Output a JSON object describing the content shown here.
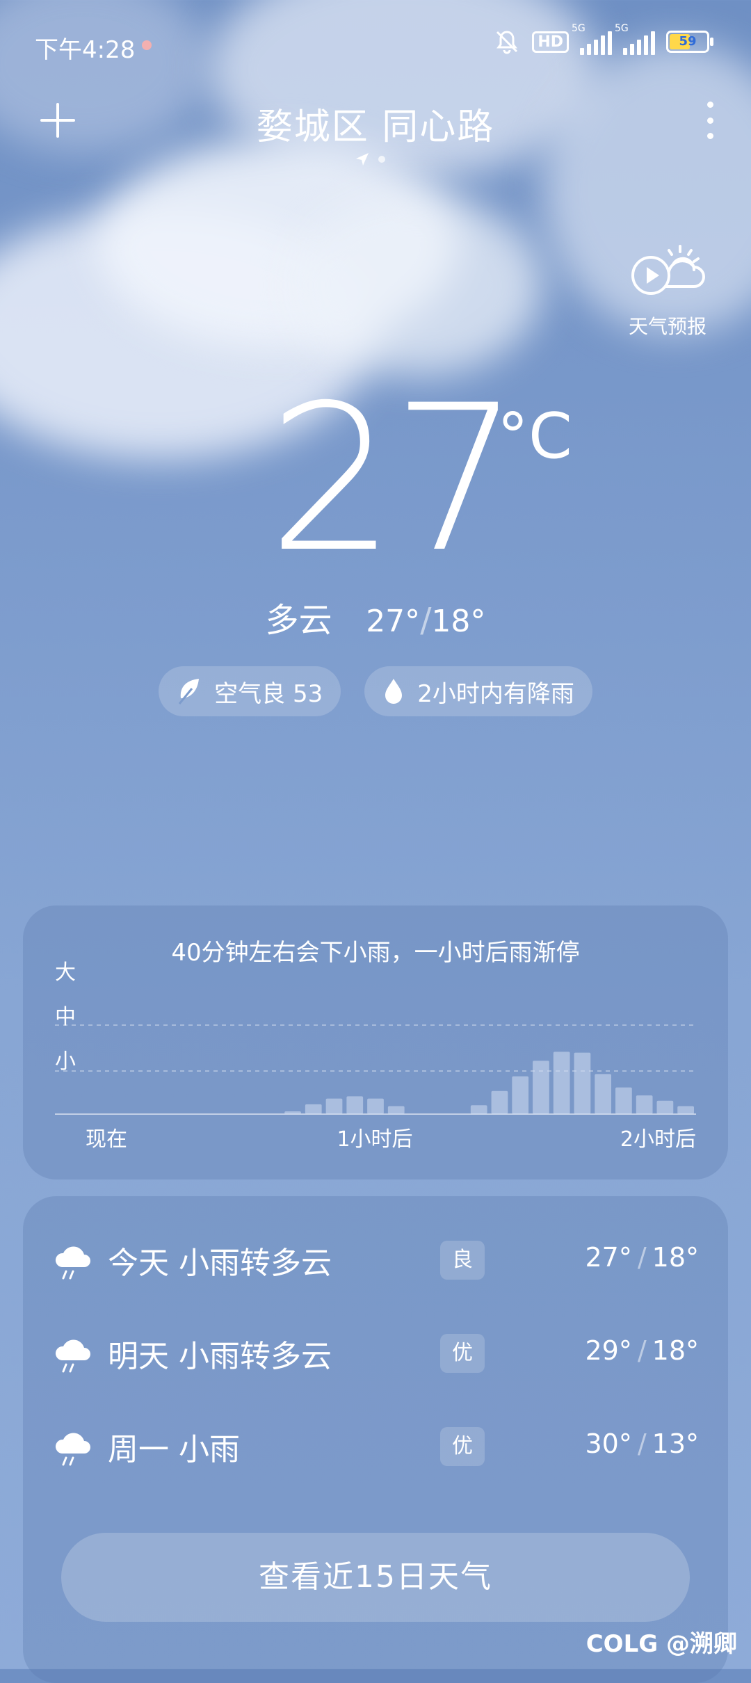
{
  "status_bar": {
    "time": "下午4:28",
    "battery": "59",
    "hd": "HD",
    "net1": "5G",
    "net2": "5G"
  },
  "header": {
    "location": "婺城区 同心路"
  },
  "forecast_video": {
    "label": "天气预报"
  },
  "current": {
    "temp": "27",
    "unit": "°C",
    "condition": "多云",
    "high": "27°",
    "low": "18°"
  },
  "pills": {
    "air": "空气良 53",
    "rain": "2小时内有降雨"
  },
  "rain": {
    "title": "40分钟左右会下小雨，一小时后雨渐停",
    "y_labels": [
      "大",
      "中",
      "小"
    ],
    "x_labels": [
      "现在",
      "1小时后",
      "2小时后"
    ]
  },
  "chart_data": {
    "type": "bar",
    "title": "40分钟左右会下小雨，一小时后雨渐停",
    "categories": [
      "现在",
      "1小时后",
      "2小时后"
    ],
    "ylabels": [
      "小",
      "中",
      "大"
    ],
    "ylim": [
      0,
      3
    ],
    "values": [
      0,
      0,
      0,
      0,
      0,
      0,
      0,
      0,
      0,
      0,
      0,
      0.05,
      0.22,
      0.35,
      0.4,
      0.35,
      0.18,
      0,
      0,
      0,
      0.2,
      0.52,
      0.85,
      1.2,
      1.4,
      1.38,
      0.9,
      0.6,
      0.42,
      0.3,
      0.18
    ],
    "grid": true
  },
  "daily": [
    {
      "label": "今天  小雨转多云",
      "aqi": "良",
      "high": "27°",
      "low": "18°",
      "icon": "rain-cloud-icon"
    },
    {
      "label": "明天  小雨转多云",
      "aqi": "优",
      "high": "29°",
      "low": "18°",
      "icon": "rain-cloud-icon"
    },
    {
      "label": "周一  小雨",
      "aqi": "优",
      "high": "30°",
      "low": "13°",
      "icon": "rain-cloud-icon"
    }
  ],
  "button_15day": "查看近15日天气",
  "watermark": "COLG @溯卿",
  "colors": {
    "bar": "#c6d3ea",
    "accent_battery": "#ffd84a"
  }
}
